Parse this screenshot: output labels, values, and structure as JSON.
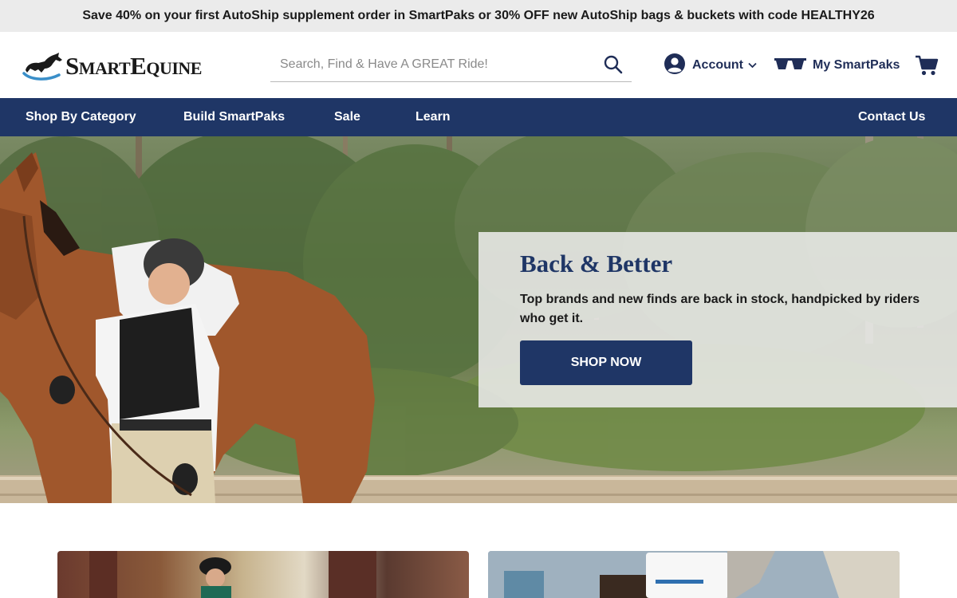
{
  "promo": {
    "text": "Save 40% on your first AutoShip supplement order in SmartPaks or 30% OFF new AutoShip bags & buckets with code HEALTHY26"
  },
  "header": {
    "logo_text": "SmartEquine",
    "search": {
      "placeholder": "Search, Find & Have A GREAT Ride!",
      "value": ""
    },
    "account_label": "Account",
    "mysmartpaks_label": "My SmartPaks"
  },
  "nav": {
    "items": [
      {
        "label": "Shop By Category"
      },
      {
        "label": "Build SmartPaks"
      },
      {
        "label": "Sale"
      },
      {
        "label": "Learn"
      },
      {
        "label": "Contact Us"
      }
    ]
  },
  "hero": {
    "title": "Back & Better",
    "text": "Top brands and new finds are back in stock, handpicked by riders who get it.",
    "button_label": "SHOP NOW"
  },
  "icons": {
    "search": "search-icon",
    "account": "user-circle-icon",
    "account_chevron": "chevron-down-icon",
    "mysmartpaks": "smartpak-cups-icon",
    "cart": "cart-icon",
    "logo": "horse-logo-icon"
  },
  "colors": {
    "brand_navy": "#1f3666",
    "text_navy": "#1f2d57",
    "promo_bg": "#ebebeb",
    "logo_blue": "#3a8fc9"
  }
}
